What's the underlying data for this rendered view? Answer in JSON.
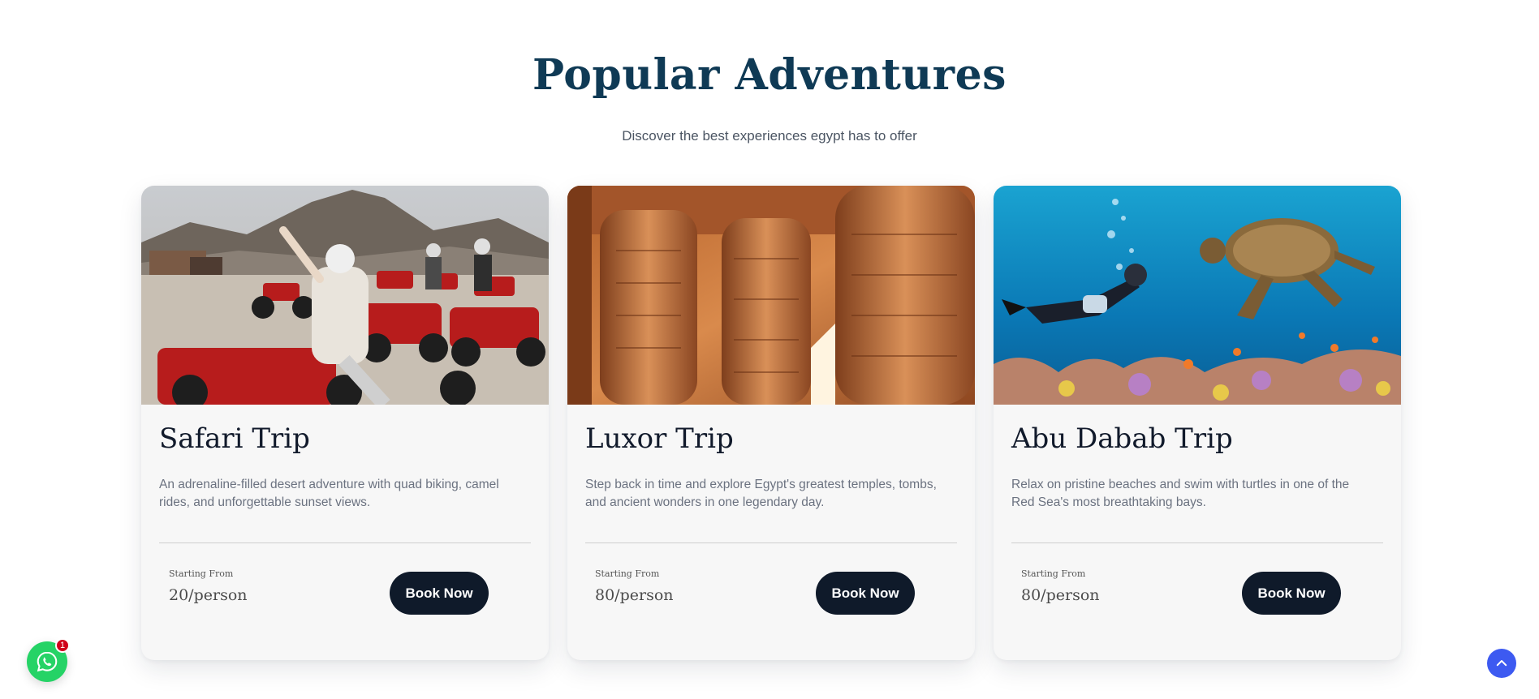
{
  "section": {
    "title": "Popular Adventures",
    "subtitle": "Discover the best experiences egypt has to offer"
  },
  "cards": [
    {
      "title": "Safari Trip",
      "description": "An adrenaline-filled desert adventure with quad biking, camel rides, and unforgettable sunset views.",
      "price_label": "Starting From",
      "price": "20/person",
      "button_label": "Book Now"
    },
    {
      "title": "Luxor Trip",
      "description": "Step back in time and explore Egypt's greatest temples, tombs, and ancient wonders in one legendary day.",
      "price_label": "Starting From",
      "price": "80/person",
      "button_label": "Book Now"
    },
    {
      "title": "Abu Dabab Trip",
      "description": "Relax on pristine beaches and swim with turtles in one of the Red Sea's most breathtaking bays.",
      "price_label": "Starting From",
      "price": "80/person",
      "button_label": "Book Now"
    }
  ],
  "whatsapp": {
    "badge_count": "1",
    "icon": "whatsapp-icon",
    "color": "#25d366"
  },
  "scroll_top": {
    "icon": "chevron-up-icon",
    "color": "#3d5af1"
  },
  "colors": {
    "title": "#0f3a55",
    "button": "#0f1a2a",
    "card_bg": "#f7f7f7"
  }
}
